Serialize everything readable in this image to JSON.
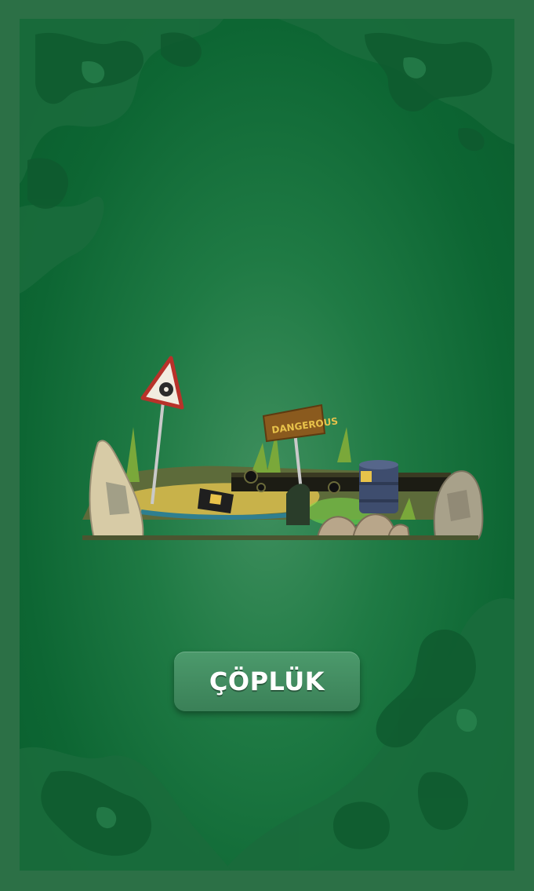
{
  "level": {
    "name": "ÇÖPLÜK",
    "sign_text": "DANGEROUS"
  },
  "colors": {
    "frame": "#2c7046",
    "background_dark": "#0a5c2d",
    "background_light": "#3f8f5e",
    "button": "#4c9a6c",
    "toxic_green": "#7be04a",
    "sign_wood": "#8a5a1e"
  },
  "icons": [
    "radiation-warning-sign-icon",
    "dangerous-sign-icon",
    "toxic-barrel-icon",
    "rock-icon",
    "camouflage-pattern"
  ]
}
